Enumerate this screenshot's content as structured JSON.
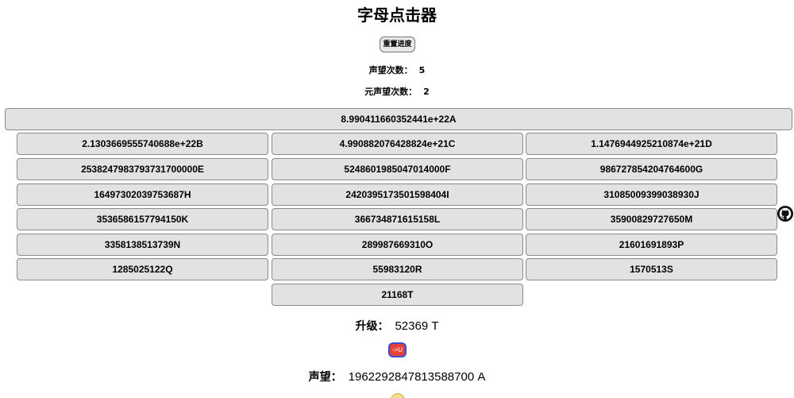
{
  "title": "字母点击器",
  "reset_label": "重置进度",
  "prestige_count": {
    "label": "声望次数：",
    "value": "5"
  },
  "meta_prestige_count": {
    "label": "元声望次数：",
    "value": "2"
  },
  "letters": [
    {
      "amount": "8.990411660352441e+22",
      "letter": "A",
      "text": "8.990411660352441e+22A"
    },
    {
      "text": "2.1303669555740688e+22B"
    },
    {
      "text": "4.990882076428824e+21C"
    },
    {
      "text": "1.1476944925210874e+21D"
    },
    {
      "text": "2538247983793731700000E"
    },
    {
      "text": "5248601985047014000F"
    },
    {
      "text": "986727854204764600G"
    },
    {
      "text": "16497302039753687H"
    },
    {
      "text": "2420395173501598404I"
    },
    {
      "text": "31085009399038930J"
    },
    {
      "text": "3536586157794150K"
    },
    {
      "text": "366734871615158L"
    },
    {
      "text": "35900829727650M"
    },
    {
      "text": "3358138513739N"
    },
    {
      "text": "289987669310O"
    },
    {
      "text": "21601691893P"
    },
    {
      "text": "1285025122Q"
    },
    {
      "text": "55983120R"
    },
    {
      "text": "1570513S"
    },
    {
      "text": "21168T"
    }
  ],
  "upgrade": {
    "label": "升级：",
    "value": "52369 T",
    "button_label": "->U"
  },
  "prestige": {
    "label": "声望：",
    "value": "1962292847813588700 A"
  },
  "colors": {
    "button_bg": "#e2e2e2",
    "upgrade_button_bg": "#e8413a",
    "upgrade_button_border": "#3a4bd1"
  },
  "icons": {
    "corner": "github-icon"
  }
}
